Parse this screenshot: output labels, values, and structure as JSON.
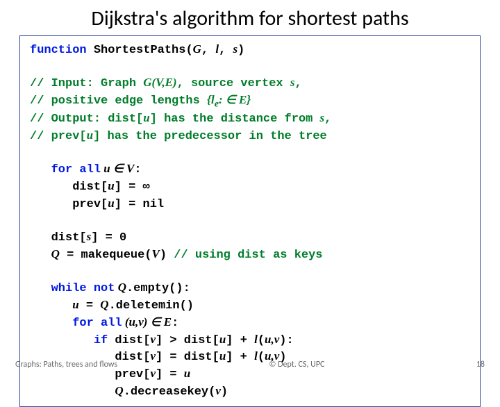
{
  "title": "Dijkstra's algorithm for shortest paths",
  "code": {
    "l1_kw": "function",
    "l1_fn": "ShortestPaths(",
    "l1_arg1": "G",
    "l1_c1": ", ",
    "l1_arg2": "l",
    "l1_c2": ", ",
    "l1_arg3": "s",
    "l1_end": ")",
    "c1a": "// Input: Graph ",
    "c1b": "G(V,E)",
    "c1c": ", source vertex ",
    "c1d": "s",
    "c1e": ",",
    "c2a": "//        positive edge lengths ",
    "c2b": "{l",
    "c2sub": "e",
    "c2c": ": ∈ E}",
    "c3a": "// Output: dist[",
    "c3b": "u",
    "c3c": "] has the distance from ",
    "c3d": "s",
    "c3e": ",",
    "c4a": "//         prev[",
    "c4b": "u",
    "c4c": "] has the predecessor in the tree",
    "f1_kw": "for all",
    "f1_e": " u ∈ V",
    "f1_c": ":",
    "f2a": "dist[",
    "f2b": "u",
    "f2c": "] = ∞",
    "f3a": "prev[",
    "f3b": "u",
    "f3c": "] = nil",
    "d1a": "dist[",
    "d1b": "s",
    "d1c": "] = 0",
    "q1a": "Q",
    "q1b": " = makequeue(",
    "q1c": "V",
    "q1d": ")   ",
    "q1com": "// using dist as keys",
    "w1": "while not",
    "w1b": " Q",
    "w1c": ".empty():",
    "w2a": "u",
    "w2b": " = ",
    "w2c": "Q",
    "w2d": ".deletemin()",
    "w3": "for all",
    "w3b": " (u,v) ∈ E",
    "w3c": ":",
    "w4": "if",
    "w4a": " dist[",
    "w4b": "v",
    "w4c": "] > dist[",
    "w4d": "u",
    "w4e": "] + ",
    "w4f": "l",
    "w4g": "(",
    "w4h": "u,v",
    "w4i": "):",
    "w5a": "dist[",
    "w5b": "v",
    "w5c": "] = dist[",
    "w5d": "u",
    "w5e": "] + ",
    "w5f": "l",
    "w5g": "(",
    "w5h": "u,v",
    "w5i": ")",
    "w6a": "prev[",
    "w6b": "v",
    "w6c": "] = ",
    "w6d": "u",
    "w7a": "Q",
    "w7b": ".decreasekey(",
    "w7c": "v",
    "w7d": ")"
  },
  "footer": {
    "left": "Graphs: Paths, trees and flows",
    "center": "© Dept. CS, UPC",
    "right": "18"
  }
}
